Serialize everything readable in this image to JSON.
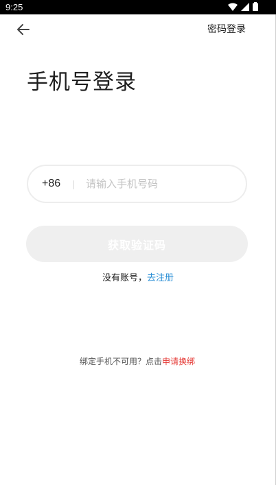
{
  "status_bar": {
    "time": "9:25"
  },
  "header": {
    "password_login_label": "密码登录"
  },
  "page": {
    "title": "手机号登录"
  },
  "phone_form": {
    "country_code": "+86",
    "phone_placeholder": "请输入手机号码",
    "phone_value": "",
    "get_code_label": "获取验证码"
  },
  "register": {
    "prompt": "没有账号，",
    "link_label": "去注册"
  },
  "rebind": {
    "prompt": "绑定手机不可用？点击",
    "link_label": "申请换绑"
  },
  "colors": {
    "link_blue": "#2b8fd6",
    "link_red": "#e53935",
    "button_disabled": "#efefef"
  },
  "icons": [
    "wifi-icon",
    "signal-icon",
    "battery-icon",
    "back-arrow-icon"
  ]
}
